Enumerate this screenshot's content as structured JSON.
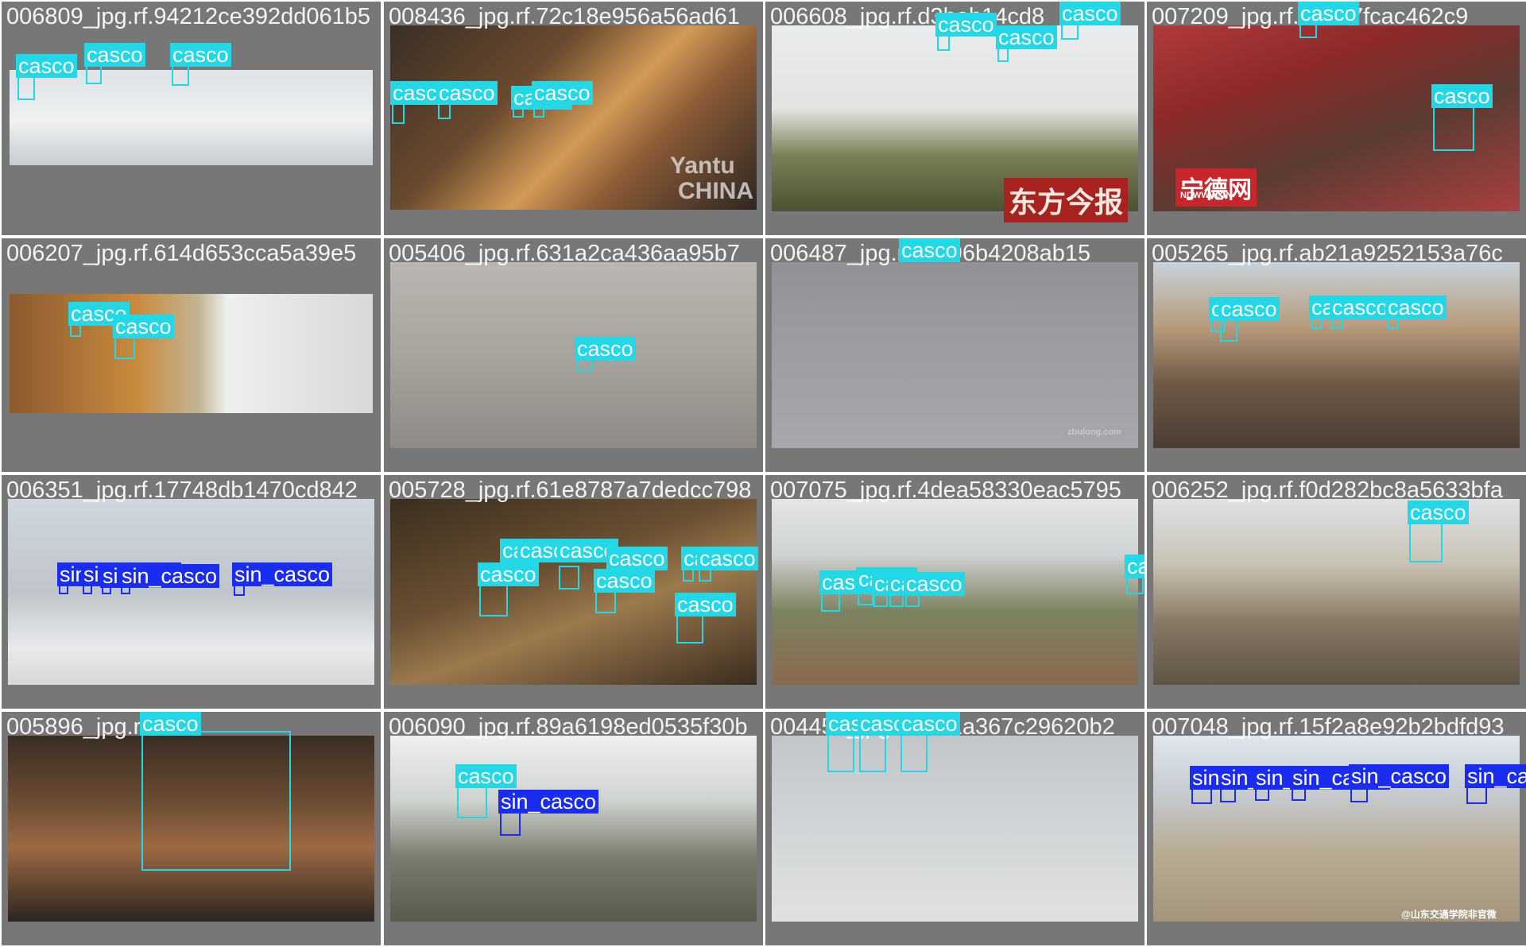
{
  "colors": {
    "cell_background": "#777777",
    "casco": "#22d8e6",
    "sin_casco": "#1a2cf0"
  },
  "class_labels": {
    "casco": "casco",
    "sin_casco": "sin_casco"
  },
  "cells": [
    {
      "title": "006809_jpg.rf.94212ce392dd061b5",
      "dets": [
        {
          "c": "casco"
        },
        {
          "c": "casco"
        },
        {
          "c": "casco"
        }
      ],
      "overlays": []
    },
    {
      "title": "008436_jpg.rf.72c18e956a56ad61",
      "dets": [
        {
          "c": "casco"
        },
        {
          "c": "casco"
        },
        {
          "c": "casco"
        },
        {
          "c": "casco"
        }
      ],
      "overlays": [
        {
          "text": "Yantu"
        },
        {
          "text": "CHINA"
        }
      ]
    },
    {
      "title": "006608_jpg.rf.d3beb14cd8",
      "dets": [
        {
          "c": "casco"
        },
        {
          "c": "casco"
        },
        {
          "c": "casco"
        }
      ],
      "overlays": [
        {
          "text": "东方今报"
        }
      ]
    },
    {
      "title": "007209_jpg.rf.d9227fcac462c9",
      "dets": [
        {
          "c": "casco"
        },
        {
          "c": "casco"
        }
      ],
      "overlays": [
        {
          "text": "宁德网"
        },
        {
          "text": "NDWWW.CN"
        }
      ]
    },
    {
      "title": "006207_jpg.rf.614d653cca5a39e5",
      "dets": [
        {
          "c": "casco"
        },
        {
          "c": "casco"
        }
      ],
      "overlays": []
    },
    {
      "title": "005406_jpg.rf.631a2ca436aa95b7",
      "dets": [
        {
          "c": "casco"
        }
      ],
      "overlays": []
    },
    {
      "title": "006487_jpg.rf.f8496b4208ab15",
      "dets": [
        {
          "c": "casco"
        }
      ],
      "overlays": [
        {
          "text": "zhulong.com"
        }
      ]
    },
    {
      "title": "005265_jpg.rf.ab21a9252153a76c",
      "dets": [
        {
          "c": "casco"
        },
        {
          "c": "casco"
        },
        {
          "c": "casco"
        },
        {
          "c": "casco"
        },
        {
          "c": "casco"
        }
      ],
      "overlays": []
    },
    {
      "title": "006351_jpg.rf.17748db1470cd842",
      "dets": [
        {
          "c": "sin_casco"
        },
        {
          "c": "sin_casco"
        },
        {
          "c": "sin_casco"
        },
        {
          "c": "sin_casco"
        },
        {
          "c": "sin_casco"
        }
      ],
      "overlays": []
    },
    {
      "title": "005728_jpg.rf.61e8787a7dedcc798",
      "dets": [
        {
          "c": "casco"
        },
        {
          "c": "casco"
        },
        {
          "c": "casco"
        },
        {
          "c": "casco"
        },
        {
          "c": "casco"
        },
        {
          "c": "casco"
        },
        {
          "c": "casco"
        },
        {
          "c": "casco"
        },
        {
          "c": "casco"
        }
      ],
      "overlays": []
    },
    {
      "title": "007075_jpg.rf.4dea58330eac5795",
      "dets": [
        {
          "c": "casco"
        },
        {
          "c": "casco"
        },
        {
          "c": "casco"
        },
        {
          "c": "casco"
        },
        {
          "c": "casco"
        },
        {
          "c": "casco"
        }
      ],
      "overlays": []
    },
    {
      "title": "006252_jpg.rf.f0d282bc8a5633bfa",
      "dets": [
        {
          "c": "casco"
        }
      ],
      "overlays": []
    },
    {
      "title": "005896_jpg.rf.",
      "dets": [
        {
          "c": "casco"
        }
      ],
      "overlays": []
    },
    {
      "title": "006090_jpg.rf.89a6198ed0535f30b",
      "dets": [
        {
          "c": "casco"
        },
        {
          "c": "sin_casco"
        }
      ],
      "overlays": []
    },
    {
      "title": "004457_jpg.rf.b0f1a367c29620b2",
      "dets": [
        {
          "c": "casco"
        },
        {
          "c": "casco"
        },
        {
          "c": "casco"
        }
      ],
      "overlays": []
    },
    {
      "title": "007048_jpg.rf.15f2a8e92b2bdfd93",
      "dets": [
        {
          "c": "sin_casco"
        },
        {
          "c": "sin_casco"
        },
        {
          "c": "sin_casco"
        },
        {
          "c": "sin_casco"
        },
        {
          "c": "sin_casco"
        },
        {
          "c": "sin_casco"
        }
      ],
      "overlays": [
        {
          "text": "@山东交通学院非官微"
        }
      ]
    }
  ]
}
